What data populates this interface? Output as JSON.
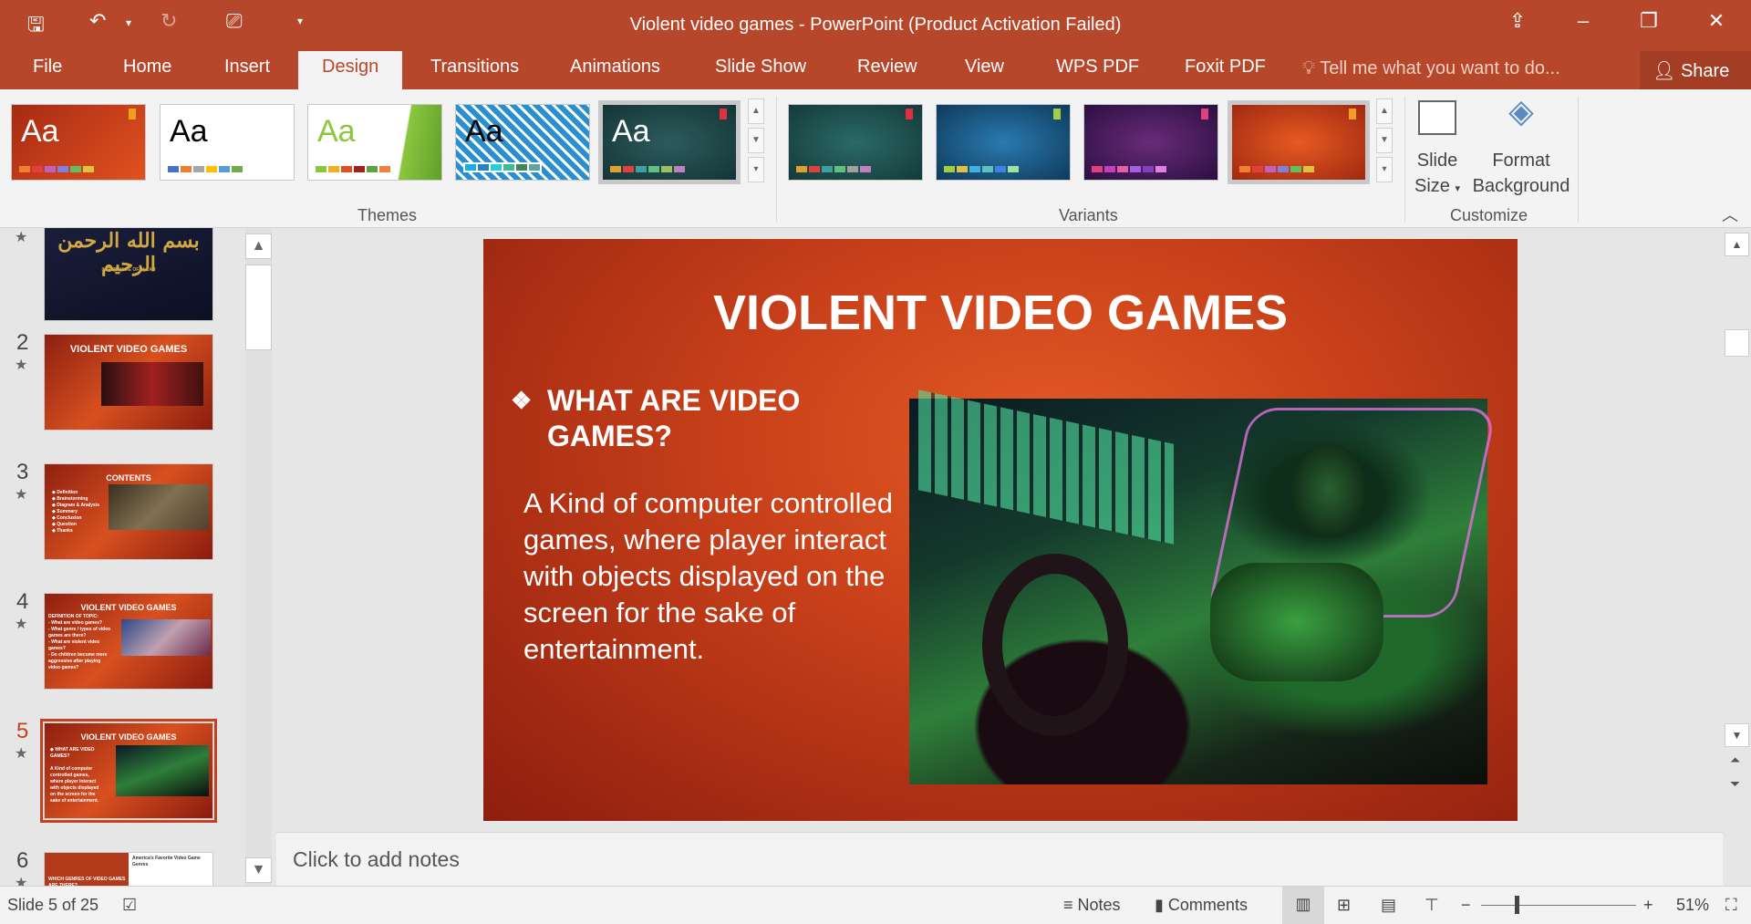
{
  "window": {
    "title": "Violent video games - PowerPoint (Product Activation Failed)",
    "restore_icon": "ribbon-display-options-icon"
  },
  "tabs": [
    "File",
    "Home",
    "Insert",
    "Design",
    "Transitions",
    "Animations",
    "Slide Show",
    "Review",
    "View",
    "WPS PDF",
    "Foxit PDF"
  ],
  "active_tab": "Design",
  "tell_me": "Tell me what you want to do...",
  "share": "Share",
  "ribbon": {
    "themes_label": "Themes",
    "variants_label": "Variants",
    "customize_label": "Customize",
    "theme_aa": "Aa",
    "slide_size": [
      "Slide",
      "Size"
    ],
    "format_background": [
      "Format",
      "Background"
    ]
  },
  "thumbnails": [
    {
      "num": "",
      "title": "",
      "caption": "IN THE NAME OF ALLAH"
    },
    {
      "num": "2",
      "title": "VIOLENT VIDEO GAMES"
    },
    {
      "num": "3",
      "title": "CONTENTS",
      "items": [
        "Definition",
        "Brainstorming",
        "Diagram & Analysis",
        "Summary",
        "Conclusion",
        "Question",
        "Thanks"
      ]
    },
    {
      "num": "4",
      "title": "VIOLENT VIDEO GAMES",
      "items": [
        "DEFINITION OF TOPIC:",
        "What are video games?",
        "What genre / types of video games are there?",
        "What are violent video games?",
        "Do children become more aggressive after playing video games?"
      ]
    },
    {
      "num": "5",
      "title": "VIOLENT VIDEO GAMES"
    },
    {
      "num": "6",
      "title": "America's Favorite Video Game Genres",
      "sub": "WHICH GENRES OF VIDEO GAMES ARE THERE?"
    }
  ],
  "slide": {
    "title": "VIOLENT VIDEO GAMES",
    "bullet_heading": "WHAT ARE VIDEO GAMES?",
    "body": "A Kind of computer controlled games, where player interact with objects displayed on the screen for the sake of entertainment."
  },
  "notes_placeholder": "Click to add notes",
  "status": {
    "slide_counter": "Slide 5 of 25",
    "notes": "Notes",
    "comments": "Comments",
    "zoom": "51%",
    "zoom_value": 51
  },
  "colors": {
    "accent": "#b7472a",
    "slide_bg": "#c8401a"
  }
}
